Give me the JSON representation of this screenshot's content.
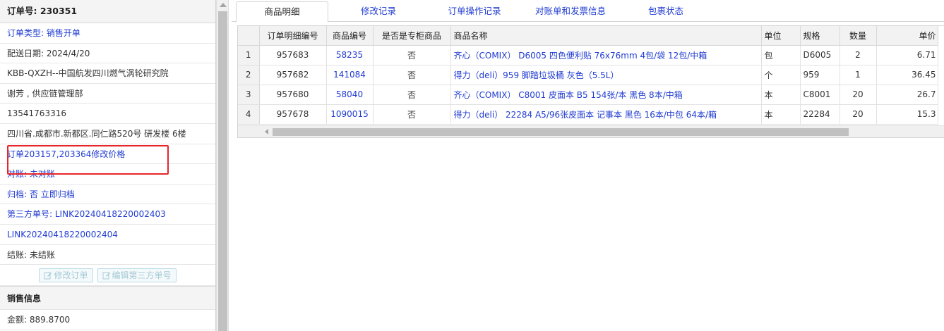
{
  "order": {
    "title": "订单号: 230351",
    "type_label": "订单类型:",
    "type_value": "销售开单",
    "delivery_date": "配送日期: 2024/4/20",
    "customer": "KBB-QXZH--中国航发四川燃气涡轮研究院",
    "contact": "谢芳 , 供应链管理部",
    "phone": "13541763316",
    "address": "四川省.成都市.新都区.同仁路520号 研发楼 6楼",
    "note": "订单203157,203364修改价格",
    "reconcile": "对账: 未对账",
    "archive_label": "归档:",
    "archive_value": "否",
    "archive_link": "立即归档",
    "third_party_label": "第三方单号:",
    "third_party_1": "LINK20240418220002403",
    "third_party_2": "LINK20240418220002404",
    "settle": "结账: 未结账",
    "btn_modify": "修改订单",
    "btn_edit_third": "编辑第三方单号"
  },
  "sales": {
    "section_title": "销售信息",
    "amount": "金额: 889.8700"
  },
  "tabs": [
    {
      "label": "商品明细",
      "active": true
    },
    {
      "label": "修改记录",
      "active": false
    },
    {
      "label": "订单操作记录",
      "active": false
    },
    {
      "label": "对账单和发票信息",
      "active": false
    },
    {
      "label": "包裹状态",
      "active": false
    }
  ],
  "table": {
    "headers": [
      "订单明细编号",
      "商品编号",
      "是否是专柜商品",
      "商品名称",
      "单位",
      "规格",
      "数量",
      "单价"
    ],
    "rows": [
      {
        "n": "1",
        "detail_id": "957683",
        "sku": "58235",
        "counter": "否",
        "name": "齐心（COMIX） D6005 四色便利贴 76x76mm 4包/袋 12包/中箱",
        "unit": "包",
        "spec": "D6005",
        "qty": "2",
        "price": "6.71"
      },
      {
        "n": "2",
        "detail_id": "957682",
        "sku": "141084",
        "counter": "否",
        "name": "得力（deli）959 脚踏垃圾桶 灰色（5.5L）",
        "unit": "个",
        "spec": "959",
        "qty": "1",
        "price": "36.45"
      },
      {
        "n": "3",
        "detail_id": "957680",
        "sku": "58040",
        "counter": "否",
        "name": "齐心（COMIX） C8001 皮面本 B5 154张/本 黑色 8本/中箱",
        "unit": "本",
        "spec": "C8001",
        "qty": "20",
        "price": "26.7"
      },
      {
        "n": "4",
        "detail_id": "957678",
        "sku": "1090015",
        "counter": "否",
        "name": "得力（deli） 22284 A5/96张皮面本 记事本 黑色 16本/中包 64本/箱",
        "unit": "本",
        "spec": "22284",
        "qty": "20",
        "price": "15.3"
      }
    ]
  }
}
